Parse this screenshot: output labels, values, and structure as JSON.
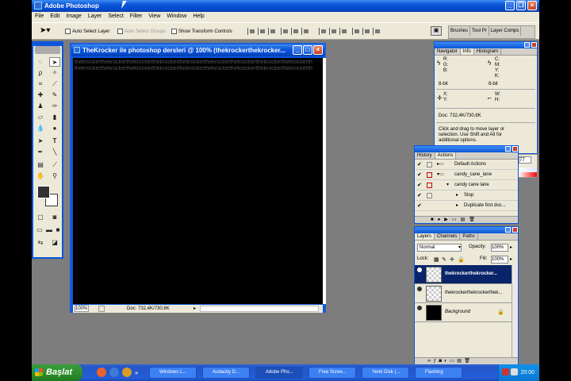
{
  "app": {
    "title": "Adobe Photoshop"
  },
  "menu": [
    "File",
    "Edit",
    "Image",
    "Layer",
    "Select",
    "Filter",
    "View",
    "Window",
    "Help"
  ],
  "options": {
    "auto_select_layer": "Auto Select Layer",
    "auto_select_groups": "Auto Select Groups",
    "show_transform_controls": "Show Transform Controls"
  },
  "palette_well": [
    "Brushes",
    "Tool Pr",
    "Layer Comps"
  ],
  "document": {
    "title": "TheKrocker ile photoshop dersleri @ 100% (thekrockerthekrocker...",
    "watermark_line": "thekrockerthekrockerthekrockerthekrockerthekrockerthekrockerthekrockerthekrockerthekrockerthekrockerthekrockerthekrockerthekrocker",
    "zoom": "100%",
    "doc_size": "Doc: 732,4K/730,6K"
  },
  "info": {
    "tabs": [
      "Navigator",
      "Info",
      "Histogram"
    ],
    "rgb": "R:\nG:\nB:",
    "cmyk": "C:\nM:\nY:\nK:",
    "bit_left": "8-bit",
    "bit_right": "8-bit",
    "xy": "X:\nY:",
    "wh": "W:\nH:",
    "doc_size": "Doc: 732,4K/730,6K",
    "hint": "Click and drag to move layer or selection. Use Shift and Alt for additional options."
  },
  "actions": {
    "tabs": [
      "History",
      "Actions"
    ],
    "items": [
      "Default Actions",
      "candy_cane_lane",
      "candy cane lane",
      "Stop",
      "Duplicate first doc..."
    ]
  },
  "swatch_value": "77",
  "layers": {
    "tabs": [
      "Layers",
      "Channels",
      "Paths"
    ],
    "blend_mode": "Normal",
    "opacity_label": "Opacity:",
    "opacity": "100%",
    "lock_label": "Lock:",
    "fill_label": "Fill:",
    "fill": "100%",
    "items": [
      "thekrockerthekrocker...",
      "thekrockerthekrockerthek...",
      "Background"
    ]
  },
  "taskbar": {
    "start": "Başlat",
    "tasks": [
      "Windows L...",
      "Audacity D...",
      "Adobe Pho...",
      "Free Scree...",
      "Yerel Disk (...",
      "Flashing"
    ],
    "clock": "20:00"
  },
  "colors": {
    "xp_blue": "#0a56d8",
    "start_green": "#2d8f2d",
    "canvas": "#000000",
    "desktop_gray": "#7d7d7d"
  }
}
